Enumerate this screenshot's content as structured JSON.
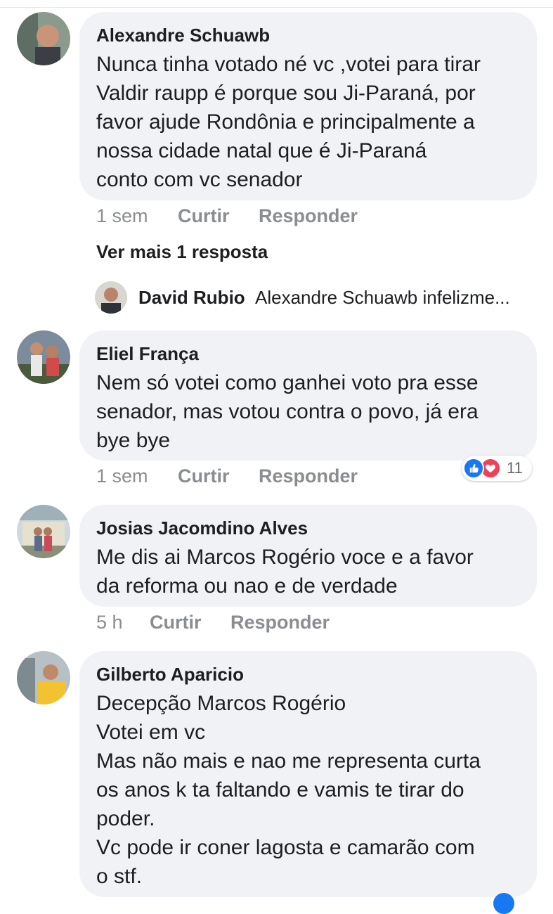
{
  "comments": [
    {
      "author": "Alexandre Schuawb",
      "text": "Nunca tinha votado né vc ,votei para tirar\nValdir raupp é porque sou Ji-Paraná, por\nfavor ajude Rondônia e principalmente a\nnossa cidade natal que é Ji-Paraná\nconto com vc senador",
      "time": "1 sem",
      "like_label": "Curtir",
      "reply_label": "Responder"
    },
    {
      "author": "Eliel França",
      "text": "Nem só votei como ganhei voto pra esse\nsenador, mas votou contra o povo, já era\nbye bye",
      "time": "1 sem",
      "like_label": "Curtir",
      "reply_label": "Responder",
      "reactions": {
        "icons": [
          "like-icon",
          "love-icon"
        ],
        "count": "11"
      }
    },
    {
      "author": "Josias Jacomdino Alves",
      "text": "Me dis ai  Marcos Rogério  voce e a favor\nda reforma  ou  nao e  de verdade",
      "time": "5 h",
      "like_label": "Curtir",
      "reply_label": "Responder"
    },
    {
      "author": "Gilberto Aparicio",
      "text": "Decepção Marcos Rogério\nVotei em vc\nMas não mais e nao me representa curta\nos anos k ta faltando e vamis te tirar do\npoder.\nVc pode ir coner lagosta e camarão com\no stf."
    }
  ],
  "more_replies": "Ver mais 1 resposta",
  "reply_preview": {
    "author": "David Rubio",
    "text": "Alexandre Schuawb infelizme..."
  },
  "colors": {
    "bubble": "#f0f2f5",
    "meta": "#8a8d91",
    "like": "#1877f2",
    "love": "#f33e58"
  }
}
